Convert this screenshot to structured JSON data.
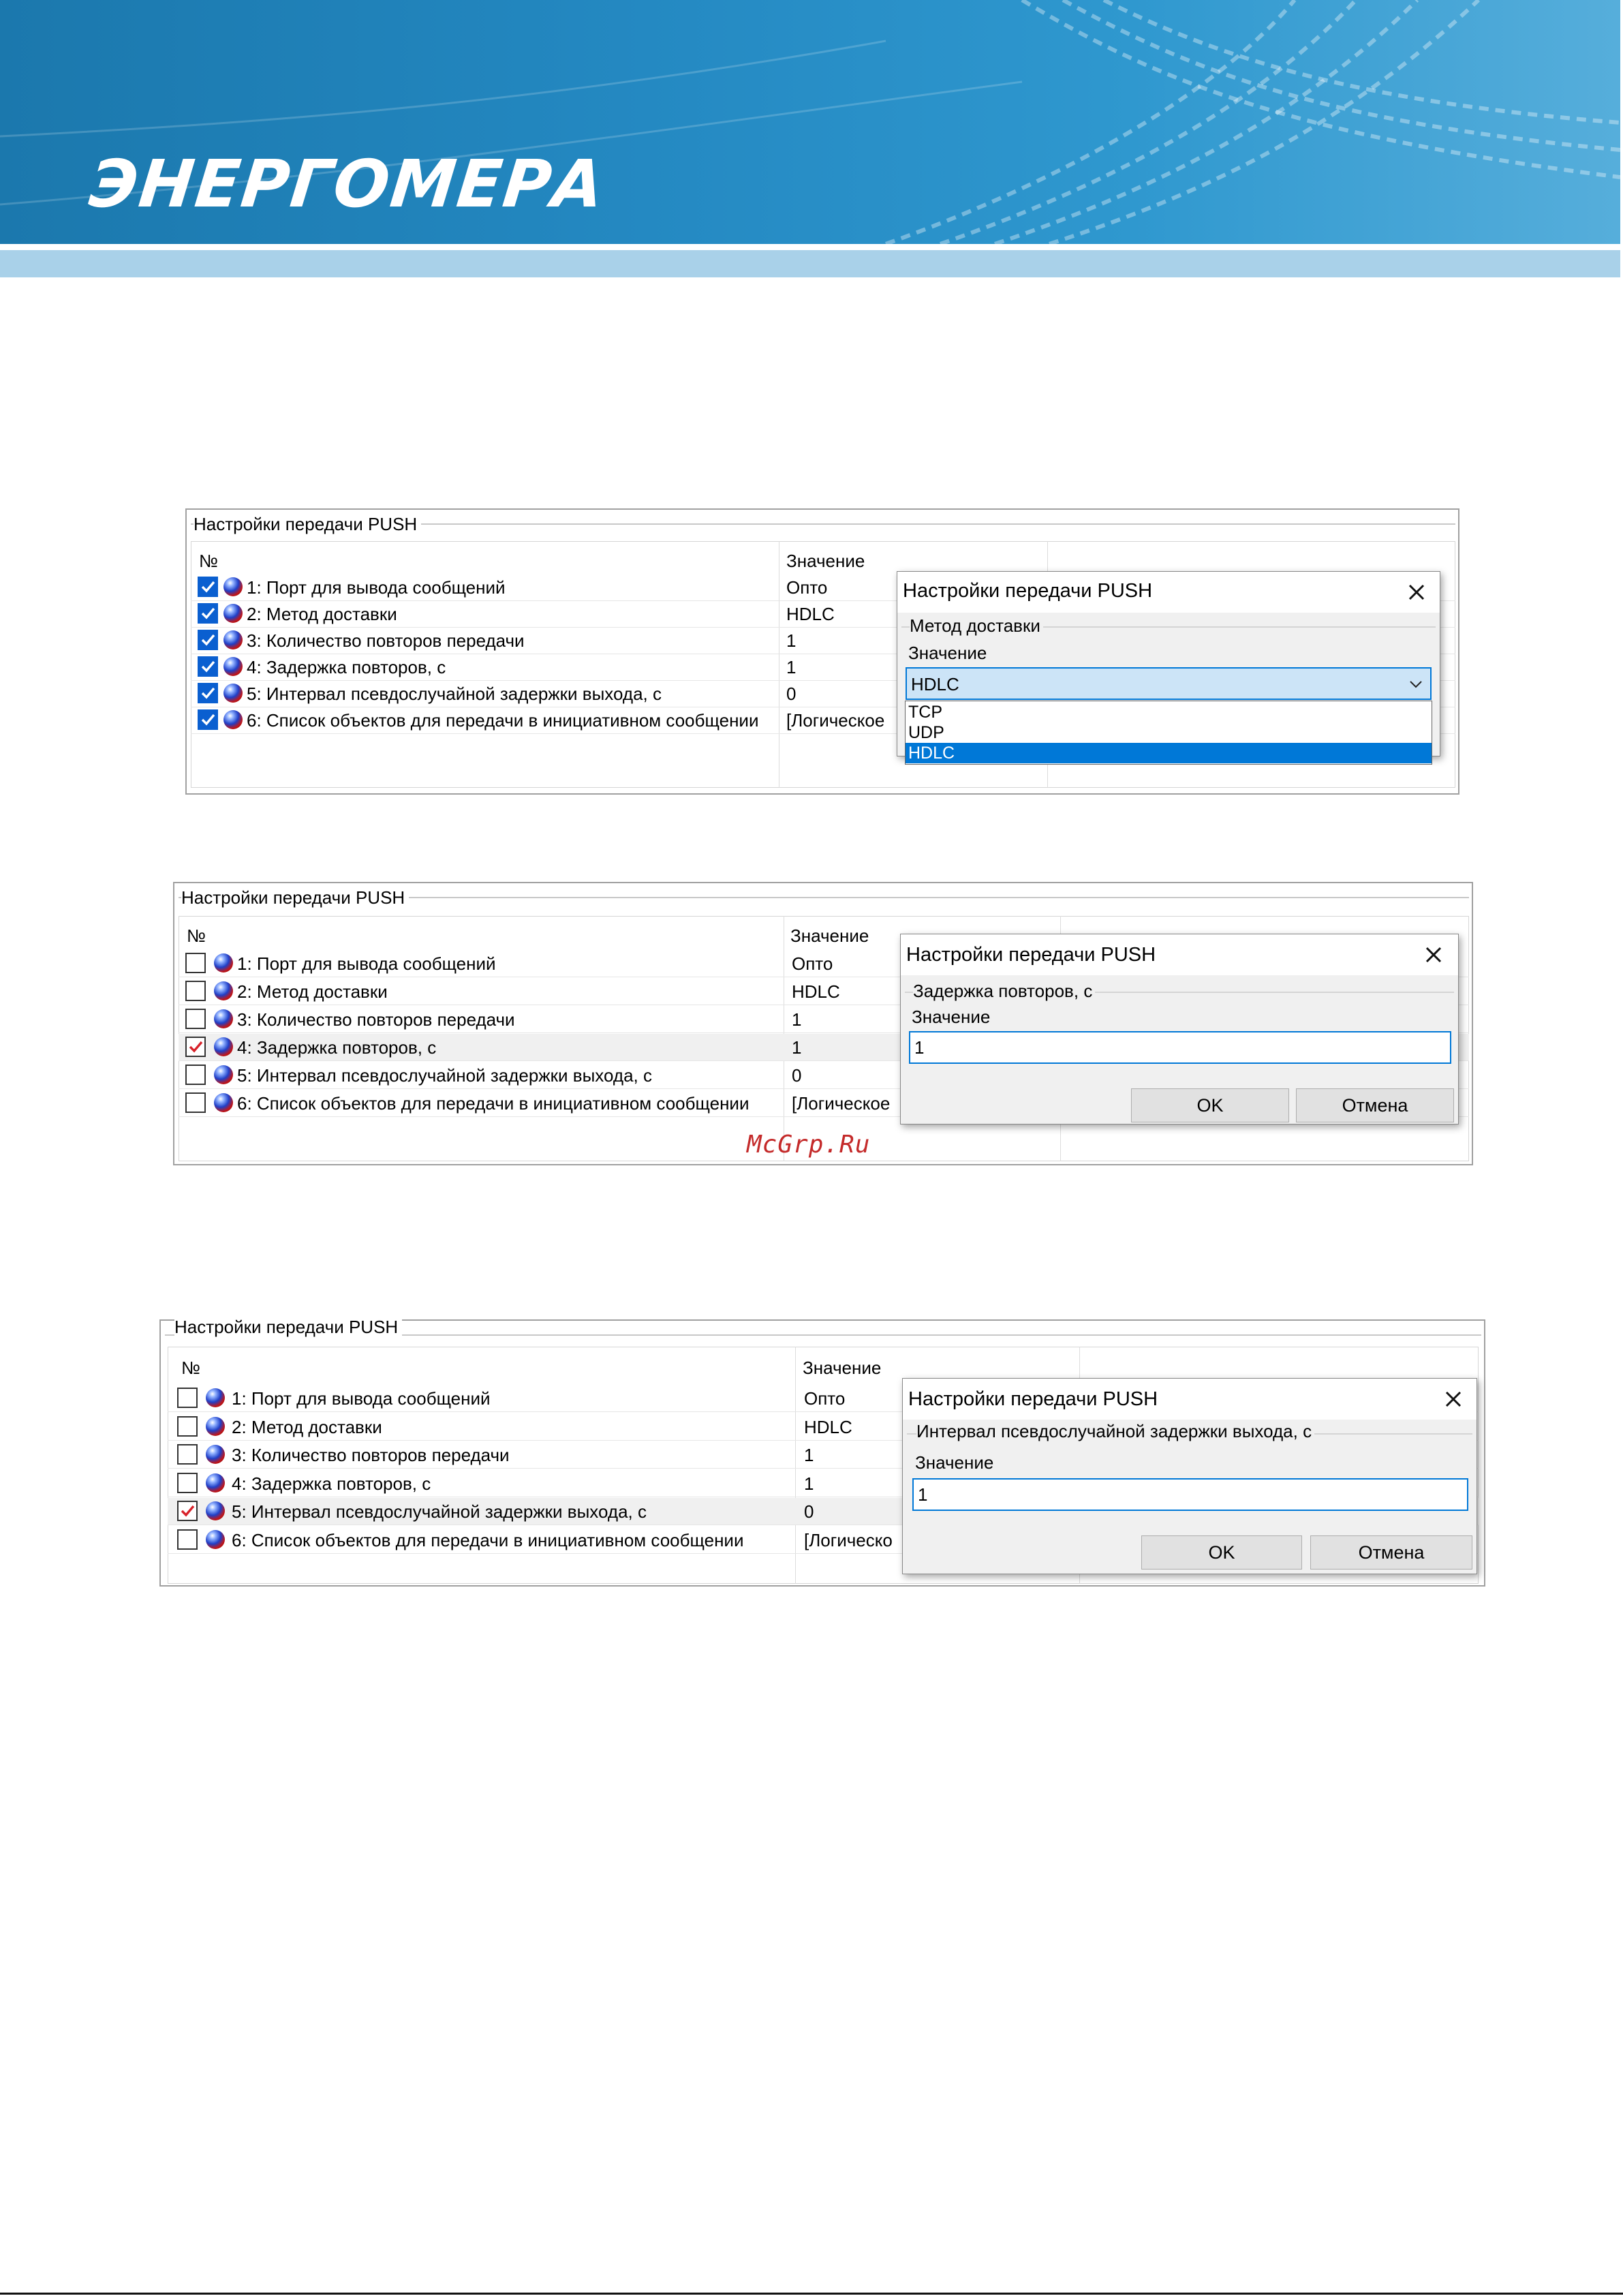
{
  "brand": {
    "logo_text": "ЭНЕРГОМЕРА"
  },
  "watermark": "McGrp.Ru",
  "panels": [
    {
      "title": "Настройки передачи PUSH",
      "header_no": "№",
      "header_value": "Значение",
      "check_color": "#0a5fd0",
      "rows": [
        {
          "label": "1: Порт для вывода сообщений",
          "value": "Опто",
          "checked": true
        },
        {
          "label": "2: Метод доставки",
          "value": "HDLC",
          "checked": true
        },
        {
          "label": "3: Количество повторов передачи",
          "value": "1",
          "checked": true
        },
        {
          "label": "4: Задержка повторов, с",
          "value": "1",
          "checked": true
        },
        {
          "label": "5: Интервал псевдослучайной задержки выхода, с",
          "value": "0",
          "checked": true
        },
        {
          "label": "6: Список объектов для передачи в инициативном сообщении",
          "value": "[Логическое",
          "checked": true
        }
      ],
      "dialog": {
        "title": "Настройки передачи PUSH",
        "group": "Метод доставки",
        "field_label": "Значение",
        "select_value": "HDLC",
        "options": [
          "TCP",
          "UDP",
          "HDLC"
        ],
        "selected_option": "HDLC"
      }
    },
    {
      "title": "Настройки передачи PUSH",
      "header_no": "№",
      "header_value": "Значение",
      "check_color": "#d8222a",
      "rows": [
        {
          "label": "1: Порт для вывода сообщений",
          "value": "Опто",
          "checked": false
        },
        {
          "label": "2: Метод доставки",
          "value": "HDLC",
          "checked": false
        },
        {
          "label": "3: Количество повторов передачи",
          "value": "1",
          "checked": false
        },
        {
          "label": "4: Задержка повторов, с",
          "value": "1",
          "checked": true
        },
        {
          "label": "5: Интервал псевдослучайной задержки выхода, с",
          "value": "0",
          "checked": false
        },
        {
          "label": "6: Список объектов для передачи в инициативном сообщении",
          "value": "[Логическое",
          "checked": false
        }
      ],
      "dialog": {
        "title": "Настройки передачи PUSH",
        "group": "Задержка повторов, с",
        "field_label": "Значение",
        "input_value": "1",
        "ok_label": "OK",
        "cancel_label": "Отмена"
      }
    },
    {
      "title": "Настройки передачи PUSH",
      "header_no": "№",
      "header_value": "Значение",
      "check_color": "#d8222a",
      "rows": [
        {
          "label": "1: Порт для вывода сообщений",
          "value": "Опто",
          "checked": false
        },
        {
          "label": "2: Метод доставки",
          "value": "HDLC",
          "checked": false
        },
        {
          "label": "3: Количество повторов передачи",
          "value": "1",
          "checked": false
        },
        {
          "label": "4: Задержка повторов, с",
          "value": "1",
          "checked": false
        },
        {
          "label": "5: Интервал псевдослучайной задержки выхода, с",
          "value": "0",
          "checked": true
        },
        {
          "label": "6: Список объектов для передачи в инициативном сообщении",
          "value": "[Логическо",
          "checked": false
        }
      ],
      "dialog": {
        "title": "Настройки передачи PUSH",
        "group": "Интервал псевдослучайной задержки выхода, с",
        "field_label": "Значение",
        "input_value": "1",
        "ok_label": "OK",
        "cancel_label": "Отмена"
      }
    }
  ]
}
